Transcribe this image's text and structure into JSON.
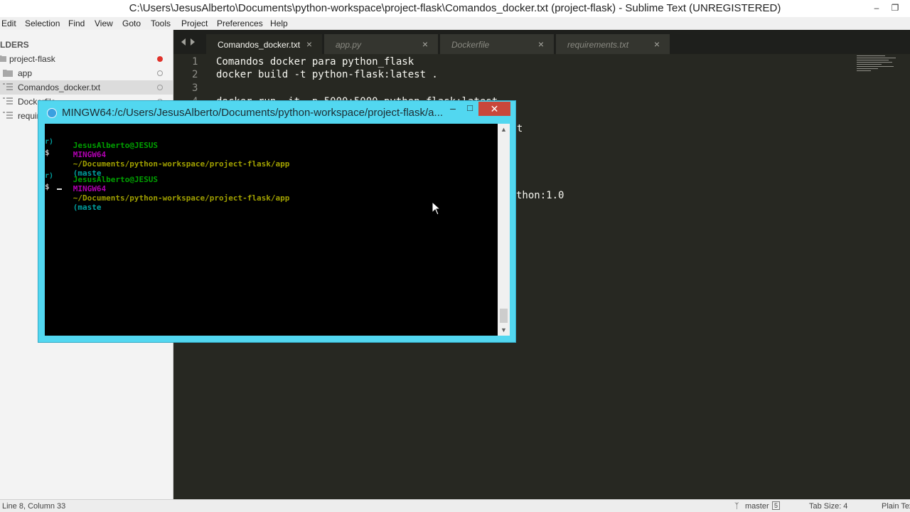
{
  "window": {
    "title": "C:\\Users\\JesusAlberto\\Documents\\python-workspace\\project-flask\\Comandos_docker.txt (project-flask) - Sublime Text (UNREGISTERED)",
    "minimize": "–",
    "maximize": "❐"
  },
  "menu": [
    "Edit",
    "Selection",
    "Find",
    "View",
    "Goto",
    "Tools",
    "Project",
    "Preferences",
    "Help"
  ],
  "sidebar": {
    "header": "LDERS",
    "items": [
      {
        "label": "project-flask",
        "icon": "folder-open-icon"
      },
      {
        "label": "app",
        "icon": "folder-icon"
      },
      {
        "label": "Comandos_docker.txt",
        "icon": "text-file-icon"
      },
      {
        "label": "Dockerfile",
        "icon": "text-file-icon"
      },
      {
        "label": "requirements.txt",
        "icon": "text-file-icon"
      }
    ]
  },
  "tabs": [
    {
      "label": "Comandos_docker.txt",
      "close": "×"
    },
    {
      "label": "app.py",
      "close": "×"
    },
    {
      "label": "Dockerfile",
      "close": "×"
    },
    {
      "label": "requirements.txt",
      "close": "×"
    }
  ],
  "editor": {
    "lines": [
      {
        "num": "1",
        "text": "Comandos docker para python_flask"
      },
      {
        "num": "2",
        "text": "docker build -t python-flask:latest ."
      },
      {
        "num": "3",
        "text": ""
      },
      {
        "num": "4",
        "text": "docker run -it -p 5000:5000 python-flask:latest"
      },
      {
        "num": "5",
        "text": "est"
      },
      {
        "num": "6",
        "text": ""
      },
      {
        "num": "7",
        "text": ""
      },
      {
        "num": "8",
        "text": "thon:1.0"
      }
    ]
  },
  "terminal": {
    "title": "MINGW64:/c/Users/JesusAlberto/Documents/python-workspace/project-flask/a...",
    "close": "✕",
    "prompt_user": "JesusAlberto@JESUS",
    "prompt_env": "MINGW64",
    "prompt_path": "~/Documents/python-workspace/project-flask/app",
    "prompt_branch": "(maste",
    "prompt_branch_wrap": "r)",
    "prompt_symbol": "$"
  },
  "status": {
    "position": "Line 8, Column 33",
    "branch": "master",
    "branch_count": "5",
    "tab_size": "Tab Size: 4",
    "syntax": "Plain Text"
  },
  "colors": {
    "editor_bg": "#272822",
    "terminal_border": "#52d7f0",
    "close_red": "#c9473b"
  }
}
